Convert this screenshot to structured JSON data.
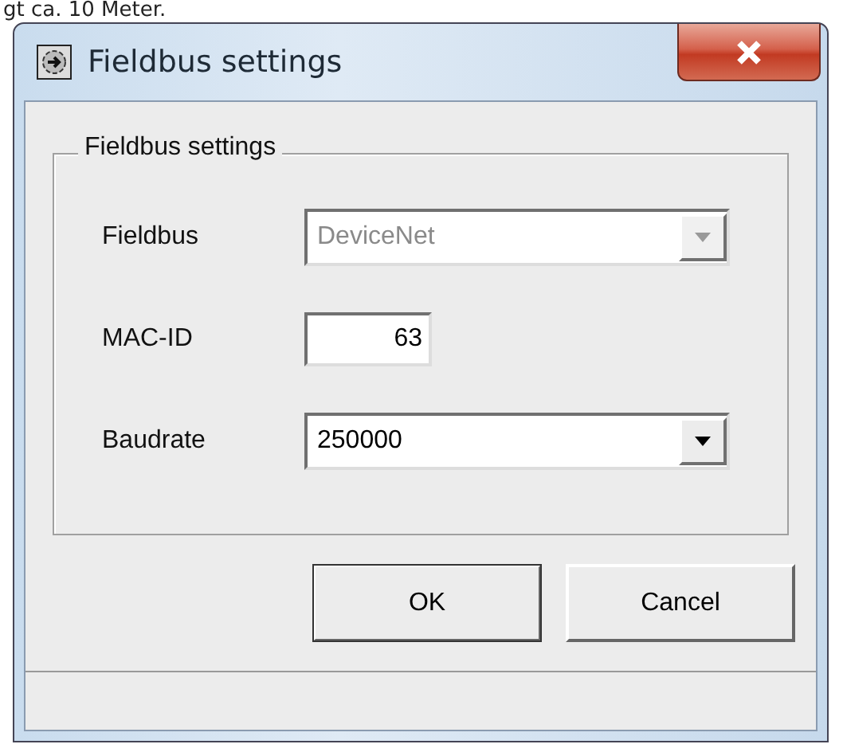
{
  "caption": "gt ca. 10 Meter.",
  "window": {
    "title": "Fieldbus settings"
  },
  "group": {
    "title": "Fieldbus settings",
    "fields": [
      {
        "kind": "combo",
        "label": "Fieldbus",
        "value": "DeviceNet",
        "disabled": true
      },
      {
        "kind": "number",
        "label": "MAC-ID",
        "value": "63",
        "disabled": false
      },
      {
        "kind": "combo",
        "label": "Baudrate",
        "value": "250000",
        "disabled": false
      }
    ]
  },
  "buttons": [
    {
      "label": "OK",
      "default": true
    },
    {
      "label": "Cancel",
      "default": false
    }
  ]
}
